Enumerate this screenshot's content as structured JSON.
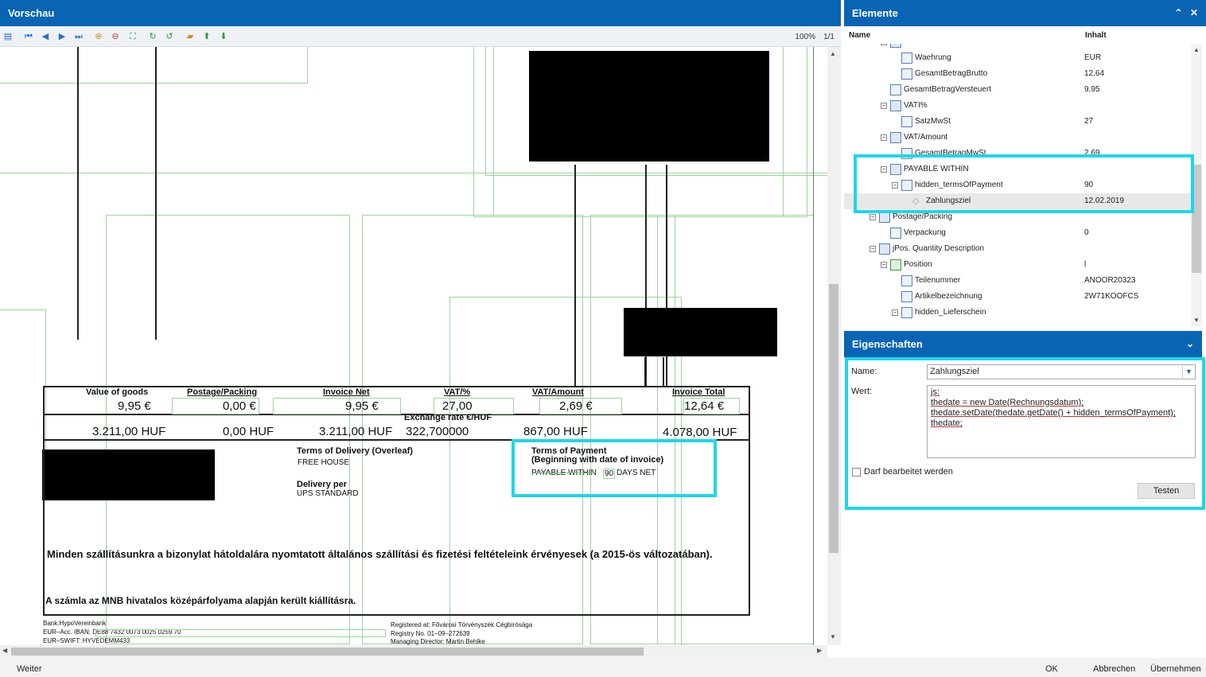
{
  "preview": {
    "title": "Vorschau",
    "zoom": "100%",
    "pages": "1/1",
    "toolbar": [
      "layout-icon",
      "first-page-icon",
      "prev-page-icon",
      "next-page-icon",
      "last-page-icon",
      "zoom-in-icon",
      "zoom-out-icon",
      "fit-page-icon",
      "rotate-icon",
      "refresh-icon",
      "open-icon",
      "upload-icon",
      "download-icon"
    ],
    "invoice": {
      "headers": [
        "Value of goods",
        "Postage/Packing",
        "Invoice Net",
        "VAT/%",
        "VAT/Amount",
        "Invoice Total"
      ],
      "values_eur": [
        "9,95 €",
        "0,00 €",
        "9,95 €",
        "27,00",
        "2,69 €",
        "12,64 €"
      ],
      "exchange_rate_label": "Exchange rate  €/HUF",
      "values_huf": [
        "3.211,00 HUF",
        "0,00 HUF",
        "3.211,00 HUF",
        "322,700000",
        "867,00 HUF",
        "4.078,00 HUF"
      ],
      "terms_delivery_title": "Terms of Delivery (Overleaf)",
      "terms_delivery_value": "FREE HOUSE",
      "delivery_per_title": "Delivery per",
      "delivery_per_value": "UPS STANDARD",
      "terms_payment_title": "Terms of Payment",
      "terms_payment_sub": "(Beginning with date of invoice)",
      "terms_payment_prefix": "PAYABLE WITHIN",
      "terms_payment_days": "90",
      "terms_payment_suffix": "DAYS NET",
      "hungarian_line1": "Minden szállításunkra a bizonylat hátoldalára nyomtatott általános szállítási és fizetési feltételeink érvényesek (a 2015-ös változatában).",
      "hungarian_line2": "A számla az MNB hivatalos középárfolyama alapján került kiállításra.",
      "bank_line1": "Bank:HypoVereinbank",
      "bank_line2": "EUR–Acc. IBAN: DE88 7432 0073 0025 0259 70",
      "bank_line3": "EUR–SWIFT: HYVEDEMM433",
      "reg_line1": "Registered at: Fővárosi Törvényszék Cégbírósága",
      "reg_line2": "Registry No. 01–09–272639",
      "reg_line3": "Managing Director: Martin Behlke"
    }
  },
  "elements": {
    "title": "Elemente",
    "col_name": "Name",
    "col_content": "Inhalt",
    "rows": [
      {
        "label": "Waehrung",
        "value": "EUR"
      },
      {
        "label": "GesamtBetragBrutto",
        "value": "12,64"
      },
      {
        "label": "GesamtBetragVersteuert",
        "value": "9,95"
      },
      {
        "label": "VATI%",
        "value": ""
      },
      {
        "label": "SatzMwSt",
        "value": "27"
      },
      {
        "label": "VAT/Amount",
        "value": ""
      },
      {
        "label": "GesamtBetragMwSt",
        "value": "2,69"
      },
      {
        "label": "PAYABLE WITHIN",
        "value": ""
      },
      {
        "label": "hidden_termsOfPayment",
        "value": "90"
      },
      {
        "label": "Zahlungsziel",
        "value": "12.02.2019"
      },
      {
        "label": "Postage/Packing",
        "value": ""
      },
      {
        "label": "Verpackung",
        "value": "0"
      },
      {
        "label": "jPos. Quantity Description",
        "value": ""
      },
      {
        "label": "Position",
        "value": "l"
      },
      {
        "label": "Teilenummer",
        "value": "ANOOR20323"
      },
      {
        "label": "Artikelbezeichnung",
        "value": "2W71KOOFCS"
      },
      {
        "label": "hidden_Lieferschein",
        "value": ""
      }
    ]
  },
  "properties": {
    "title": "Eigenschaften",
    "name_label": "Name:",
    "name_value": "Zahlungsziel",
    "wert_label": "Wert:",
    "code": [
      "js:",
      "thedate = new Date(Rechnungsdatum);",
      "thedate.setDate(thedate.getDate() + hidden_termsOfPayment);",
      "thedate;"
    ],
    "checkbox_label": "Darf bearbeitet werden",
    "test_button": "Testen"
  },
  "footer": {
    "weiter": "Weiter",
    "ok": "OK",
    "cancel": "Abbrechen",
    "apply": "Übernehmen"
  },
  "colors": {
    "header_blue": "#0a64b4",
    "highlight_cyan": "#1ed6ea"
  }
}
